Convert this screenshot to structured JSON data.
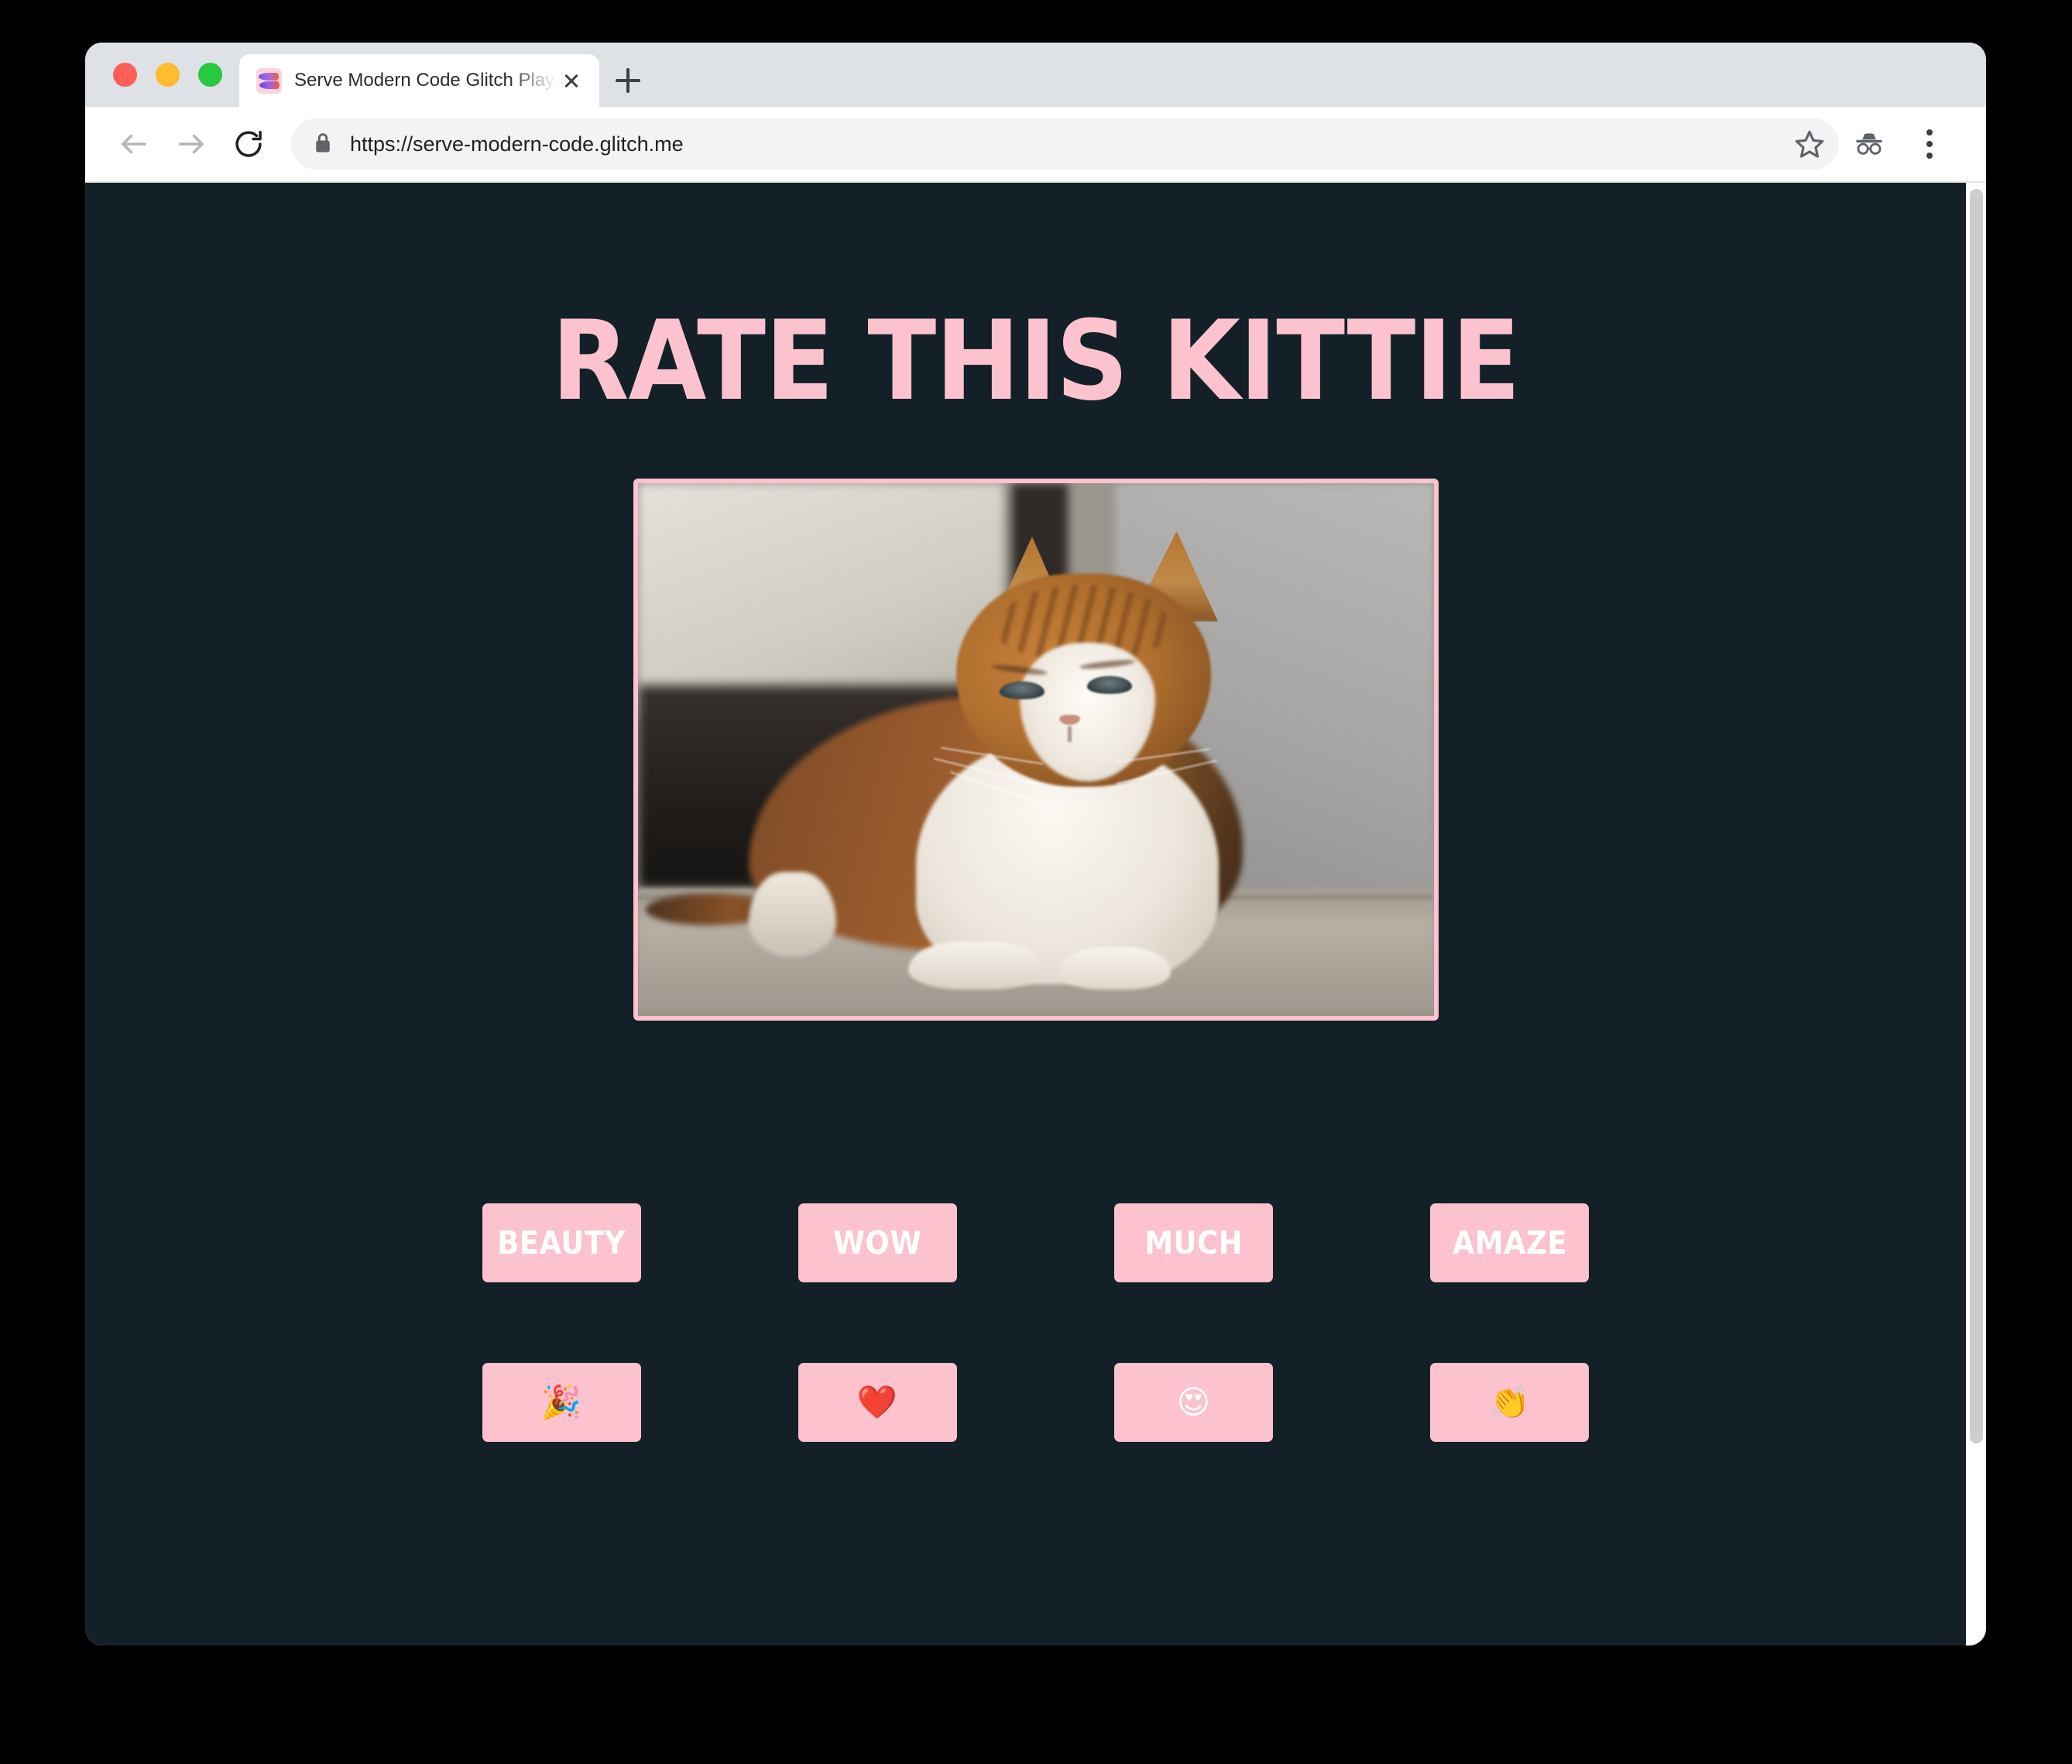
{
  "browser": {
    "window_controls": [
      {
        "name": "close",
        "color": "#ff5f57"
      },
      {
        "name": "minimize",
        "color": "#febc2e"
      },
      {
        "name": "maximize",
        "color": "#28c840"
      }
    ],
    "tab": {
      "title": "Serve Modern Code Glitch Play",
      "favicon": "two-fish-icon",
      "close_label": "×"
    },
    "new_tab_label": "+",
    "toolbar": {
      "back_icon": "back-arrow-icon",
      "forward_icon": "forward-arrow-icon",
      "reload_icon": "reload-icon",
      "lock_icon": "lock-icon",
      "url": "https://serve-modern-code.glitch.me",
      "bookmark_icon": "star-icon",
      "incognito_icon": "incognito-icon",
      "menu_icon": "three-dot-menu-icon"
    }
  },
  "page": {
    "background_color": "#132027",
    "accent_color": "#fcc2ce",
    "heading": "RATE THIS KITTIE",
    "image": {
      "alt": "grumpy orange and white tabby cat lying on the floor",
      "border_color": "#fcc2ce"
    },
    "rating_buttons": [
      {
        "label": "BEAUTY",
        "name": "rate-beauty-button"
      },
      {
        "label": "WOW",
        "name": "rate-wow-button"
      },
      {
        "label": "MUCH",
        "name": "rate-much-button"
      },
      {
        "label": "AMAZE",
        "name": "rate-amaze-button"
      }
    ],
    "emoji_buttons": [
      {
        "label": "🎉",
        "name": "rate-party-popper-button"
      },
      {
        "label": "❤️",
        "name": "rate-heart-button"
      },
      {
        "label": "😍",
        "name": "rate-heart-eyes-button"
      },
      {
        "label": "👏",
        "name": "rate-clap-button"
      }
    ]
  }
}
